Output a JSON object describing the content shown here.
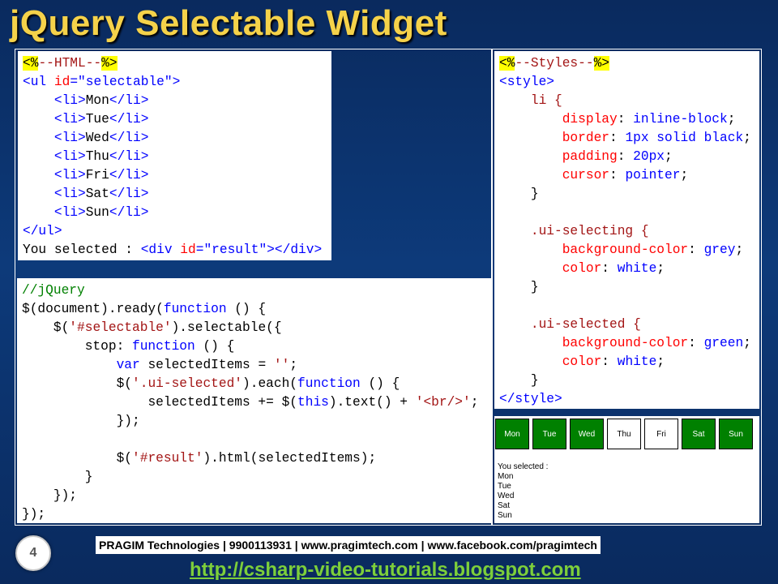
{
  "slide": {
    "title": "jQuery Selectable Widget",
    "page_number": "4",
    "footer": "PRAGIM Technologies | 9900113931 | www.pragimtech.com | www.facebook.com/pragimtech",
    "blog_url": "http://csharp-video-tutorials.blogspot.com"
  },
  "html_code": {
    "marker_open": "<%",
    "marker_label": "--HTML--",
    "marker_close": "%>",
    "ul_open_tag": "<ul",
    "ul_attr": "id",
    "ul_attr_value": "\"selectable\"",
    "items": [
      "Mon",
      "Tue",
      "Wed",
      "Thu",
      "Fri",
      "Sat",
      "Sun"
    ],
    "ul_close": "</ul>",
    "result_label": "You selected : ",
    "result_div_open": "<div",
    "result_div_attr": "id",
    "result_div_value": "\"result\"",
    "result_div_close": "></div>"
  },
  "jquery_code": {
    "comment": "//jQuery",
    "lines": {
      "l1_a": "$(document).ready(",
      "l1_kw": "function",
      "l1_b": " () {",
      "l2_a": "    $(",
      "l2_str": "'#selectable'",
      "l2_b": ").selectable({",
      "l3_a": "        stop: ",
      "l3_kw": "function",
      "l3_b": " () {",
      "l4_kw": "var",
      "l4_a": " selectedItems = ",
      "l4_str": "''",
      "l4_b": ";",
      "l5_a": "$(",
      "l5_str": "'.ui-selected'",
      "l5_b": ").each(",
      "l5_kw": "function",
      "l5_c": " () {",
      "l6_a": "selectedItems += $(",
      "l6_kw": "this",
      "l6_b": ").text() + ",
      "l6_str": "'<br/>'",
      "l6_c": ";",
      "l7": "});",
      "l8_a": "$(",
      "l8_str": "'#result'",
      "l8_b": ").html(selectedItems);",
      "l9": "}",
      "l10": "});",
      "l11": "});"
    }
  },
  "styles_code": {
    "marker_open": "<%",
    "marker_label": "--Styles--",
    "marker_close": "%>",
    "style_open": "<style>",
    "style_close": "</style>",
    "li_selector": "li {",
    "li_rules": [
      {
        "prop": "display",
        "value": "inline-block"
      },
      {
        "prop": "border",
        "value": "1px solid black"
      },
      {
        "prop": "padding",
        "value": "20px"
      },
      {
        "prop": "cursor",
        "value": "pointer"
      }
    ],
    "selecting_selector": ".ui-selecting {",
    "selecting_rules": [
      {
        "prop": "background-color",
        "value": "grey"
      },
      {
        "prop": "color",
        "value": "white"
      }
    ],
    "selected_selector": ".ui-selected {",
    "selected_rules": [
      {
        "prop": "background-color",
        "value": "green"
      },
      {
        "prop": "color",
        "value": "white"
      }
    ],
    "close_brace": "}"
  },
  "demo": {
    "days": [
      {
        "label": "Mon",
        "selected": true
      },
      {
        "label": "Tue",
        "selected": true
      },
      {
        "label": "Wed",
        "selected": true
      },
      {
        "label": "Thu",
        "selected": false
      },
      {
        "label": "Fri",
        "selected": false
      },
      {
        "label": "Sat",
        "selected": true
      },
      {
        "label": "Sun",
        "selected": true
      }
    ],
    "result_label": "You selected :",
    "result_items": [
      "Mon",
      "Tue",
      "Wed",
      "Sat",
      "Sun"
    ]
  },
  "colors": {
    "title": "#f5d24a",
    "selected_green": "#008000",
    "background": "#0d3a7a"
  }
}
